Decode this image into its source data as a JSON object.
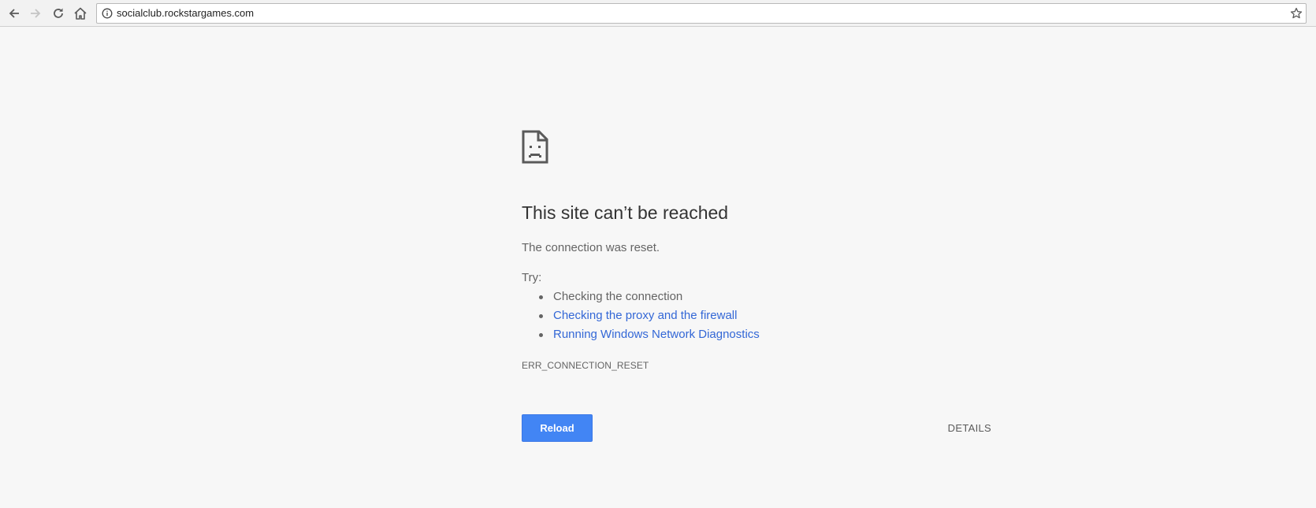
{
  "browser": {
    "url": "socialclub.rockstargames.com",
    "icons": {
      "back": "back-arrow-icon",
      "forward": "forward-arrow-icon",
      "reload": "reload-icon",
      "home": "home-icon",
      "site_info": "info-icon",
      "bookmark": "star-icon"
    }
  },
  "error_page": {
    "icon": "sad-page-icon",
    "heading": "This site can’t be reached",
    "message": "The connection was reset.",
    "try_label": "Try:",
    "suggestions": [
      {
        "text": "Checking the connection",
        "is_link": false
      },
      {
        "text": "Checking the proxy and the firewall",
        "is_link": true
      },
      {
        "text": "Running Windows Network Diagnostics",
        "is_link": true
      }
    ],
    "error_code": "ERR_CONNECTION_RESET",
    "reload_label": "Reload",
    "details_label": "DETAILS"
  },
  "colors": {
    "page_background": "#f7f7f7",
    "link": "#3367d6",
    "primary_button": "#4285f4"
  }
}
